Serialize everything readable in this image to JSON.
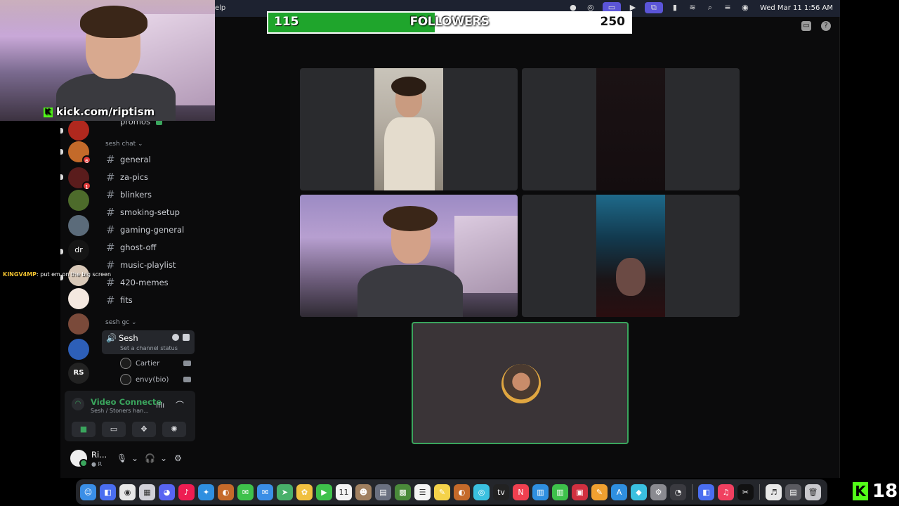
{
  "menubar": {
    "help_label": "elp",
    "clock": "Wed Mar 11  1:56 AM"
  },
  "follower_goal": {
    "current": "115",
    "label": "FOLLOWERS",
    "goal": "250",
    "progress_fraction": 0.46
  },
  "webcam": {
    "url": "kick.com/riptism"
  },
  "servers": [
    {
      "name": "server-1",
      "color": "#b0281e",
      "badge": ""
    },
    {
      "name": "server-2",
      "color": "#c36a2a",
      "badge": "6"
    },
    {
      "name": "server-3",
      "color": "#5a1c1c",
      "badge": "1"
    },
    {
      "name": "server-4",
      "color": "#4d6b2b",
      "badge": ""
    },
    {
      "name": "server-5",
      "color": "#5b6b7a",
      "badge": ""
    },
    {
      "name": "server-6",
      "color": "#151515",
      "badge": ""
    },
    {
      "name": "server-7",
      "color": "#d8c8b8",
      "badge": ""
    },
    {
      "name": "server-8",
      "color": "#f4e8e0",
      "badge": ""
    },
    {
      "name": "server-9",
      "color": "#7a4a3a",
      "badge": ""
    },
    {
      "name": "server-10",
      "color": "#2d5fb8",
      "badge": ""
    },
    {
      "name": "server-11",
      "color": "#222",
      "badge": ""
    }
  ],
  "server_initials": {
    "dr": "dr",
    "rs": "RS"
  },
  "channels": {
    "top_channel": "promos",
    "category_chat": "sesh chat",
    "text_channels": [
      "general",
      "za-pics",
      "blinkers",
      "smoking-setup",
      "gaming-general",
      "ghost-off",
      "music-playlist",
      "420-memes",
      "fits"
    ],
    "category_gc": "sesh gc",
    "voice_channel": "Sesh",
    "voice_status": "Set a channel status",
    "members": [
      "Cartier",
      "envy(bio)"
    ]
  },
  "voice_panel": {
    "title": "Video Connecte",
    "subtitle": "Sesh / Stoners han..."
  },
  "user": {
    "name": "Ri...",
    "status": "R"
  },
  "chat": {
    "user": "KINGV4MP",
    "message": ": put em on the big screen"
  },
  "dock_apps": [
    {
      "name": "finder",
      "color": "#3a8ee6",
      "glyph": "☺"
    },
    {
      "name": "app-2",
      "color": "#4a6ef0",
      "glyph": "◧"
    },
    {
      "name": "chrome",
      "color": "#e8e8e8",
      "glyph": "◉"
    },
    {
      "name": "launchpad",
      "color": "#d0d0d8",
      "glyph": "▦"
    },
    {
      "name": "discord",
      "color": "#5865f2",
      "glyph": "◕"
    },
    {
      "name": "tiktok",
      "color": "#ee1d52",
      "glyph": "♪"
    },
    {
      "name": "safari",
      "color": "#2f8fe0",
      "glyph": "✦"
    },
    {
      "name": "app-8",
      "color": "#c56a2a",
      "glyph": "◐"
    },
    {
      "name": "messages",
      "color": "#3ec14b",
      "glyph": "✉"
    },
    {
      "name": "mail",
      "color": "#3a8ee6",
      "glyph": "✉"
    },
    {
      "name": "maps",
      "color": "#48b06a",
      "glyph": "➤"
    },
    {
      "name": "photos",
      "color": "#f0c040",
      "glyph": "✿"
    },
    {
      "name": "facetime",
      "color": "#3ec14b",
      "glyph": "▶"
    },
    {
      "name": "calendar",
      "color": "#f4f4f4",
      "glyph": "11"
    },
    {
      "name": "contacts",
      "color": "#a08060",
      "glyph": "☻"
    },
    {
      "name": "app-16",
      "color": "#6a7080",
      "glyph": "▤"
    },
    {
      "name": "minecraft",
      "color": "#4a8a3a",
      "glyph": "▩"
    },
    {
      "name": "reminders",
      "color": "#f4f4f4",
      "glyph": "☰"
    },
    {
      "name": "notes",
      "color": "#f4d24a",
      "glyph": "✎"
    },
    {
      "name": "app-20",
      "color": "#c56a2a",
      "glyph": "◐"
    },
    {
      "name": "app-21",
      "color": "#3ac0e0",
      "glyph": "◎"
    },
    {
      "name": "apple-tv",
      "color": "#222",
      "glyph": "tv"
    },
    {
      "name": "news",
      "color": "#f04050",
      "glyph": "N"
    },
    {
      "name": "keynote",
      "color": "#2f8fe0",
      "glyph": "▥"
    },
    {
      "name": "numbers",
      "color": "#3ec14b",
      "glyph": "▥"
    },
    {
      "name": "app-26",
      "color": "#d03040",
      "glyph": "▣"
    },
    {
      "name": "pages",
      "color": "#f0a030",
      "glyph": "✎"
    },
    {
      "name": "app-store",
      "color": "#2f8fe0",
      "glyph": "A"
    },
    {
      "name": "app-29",
      "color": "#3ac0e0",
      "glyph": "◆"
    },
    {
      "name": "system-settings",
      "color": "#8a8a90",
      "glyph": "⚙"
    },
    {
      "name": "activity",
      "color": "#3a3a40",
      "glyph": "◔"
    },
    {
      "name": "app-32",
      "color": "#4a6ef0",
      "glyph": "◧"
    },
    {
      "name": "music",
      "color": "#f04060",
      "glyph": "♫"
    },
    {
      "name": "capcut",
      "color": "#111",
      "glyph": "✂"
    },
    {
      "name": "app-35",
      "color": "#e8e8e8",
      "glyph": "♬"
    },
    {
      "name": "app-36",
      "color": "#5a5a60",
      "glyph": "▤"
    },
    {
      "name": "trash",
      "color": "#c8c8cc",
      "glyph": "🗑"
    }
  ],
  "kick_badge": {
    "glyph": "K",
    "count": "18"
  }
}
